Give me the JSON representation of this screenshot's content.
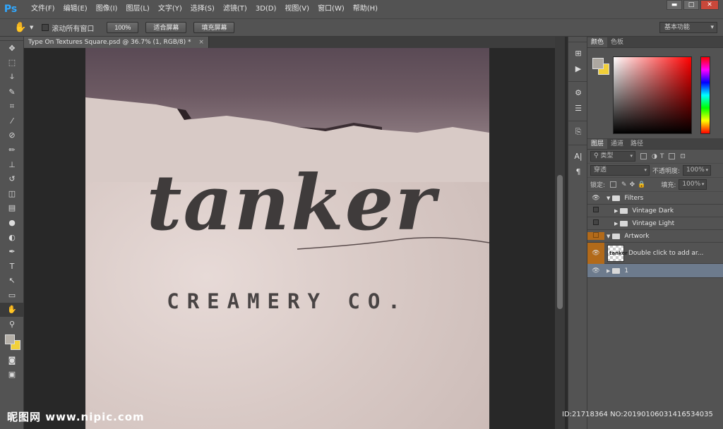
{
  "app": {
    "logo": "Ps"
  },
  "menubar": {
    "items": [
      "文件(F)",
      "编辑(E)",
      "图像(I)",
      "图层(L)",
      "文字(Y)",
      "选择(S)",
      "滤镜(T)",
      "3D(D)",
      "视图(V)",
      "窗口(W)",
      "帮助(H)"
    ],
    "window_buttons": {
      "minimize": "▬",
      "maximize": "□",
      "close": "✕"
    }
  },
  "options": {
    "tool_icon": "hand-icon",
    "scroll_all_windows": "滚动所有窗口",
    "zoom_100": "100%",
    "fit_screen": "适合屏幕",
    "fill_screen": "填充屏幕",
    "workspace": "基本功能"
  },
  "document": {
    "tab_title": "Type On Textures Square.psd @ 36.7% (1, RGB/8) *",
    "close": "×"
  },
  "artwork": {
    "title": "tanker",
    "subtitle": "CREAMERY CO."
  },
  "color_panel": {
    "tabs": [
      "颜色",
      "色板"
    ],
    "foreground": "#aca7a0",
    "background": "#f1cf38"
  },
  "layers_panel": {
    "tabs": [
      "图层",
      "通道",
      "路径"
    ],
    "filter_kind": "类型",
    "blend_mode": "穿透",
    "opacity_label": "不透明度:",
    "opacity_value": "100%",
    "lock_label": "锁定:",
    "fill_label": "填充:",
    "fill_value": "100%",
    "layers": [
      {
        "name": "Filters"
      },
      {
        "name": "Vintage Dark"
      },
      {
        "name": "Vintage Light"
      },
      {
        "name": "Artwork"
      },
      {
        "name": "Double click to add ar..."
      },
      {
        "name": "1"
      }
    ],
    "thumb_text": "tanker"
  },
  "watermark": {
    "left": "昵图网 www.nipic.com",
    "right": "ID:21718364 NO:20190106031416534035"
  },
  "colors": {
    "accent_orange": "#b26a1a",
    "selected_layer": "#6d7b8d",
    "ps_blue": "#31a8ff"
  }
}
